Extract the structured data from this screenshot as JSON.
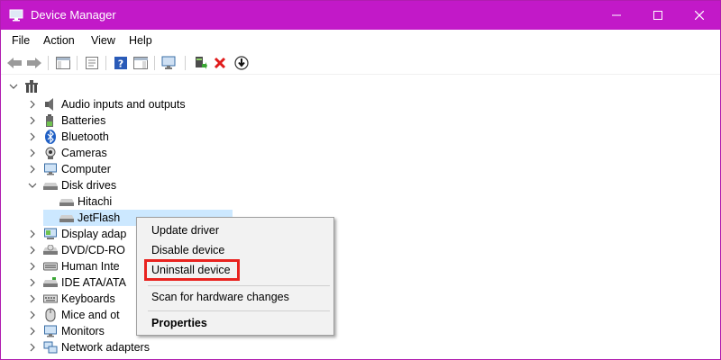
{
  "window": {
    "title": "Device Manager",
    "accent": "#c219c8"
  },
  "menu": [
    "File",
    "Action",
    "View",
    "Help"
  ],
  "toolbar": {
    "icons": [
      "back-arrow-icon",
      "forward-arrow-icon",
      "show-hide-tree-icon",
      "properties-icon",
      "help-icon",
      "action-pane-icon",
      "scan-hardware-icon",
      "update-driver-icon",
      "uninstall-icon",
      "download-icon"
    ]
  },
  "tree": {
    "root": "",
    "items": [
      "Audio inputs and outputs",
      "Batteries",
      "Bluetooth",
      "Cameras",
      "Computer",
      "Disk drives",
      "Hitachi",
      "JetFlash",
      "Display adap",
      "DVD/CD-RO",
      "Human Inte",
      "IDE ATA/ATA",
      "Keyboards",
      "Mice and ot",
      "Monitors",
      "Network adapters"
    ]
  },
  "context_menu": {
    "items": [
      "Update driver",
      "Disable device",
      "Uninstall device",
      "Scan for hardware changes",
      "Properties"
    ],
    "highlight_color": "#e8231f"
  }
}
